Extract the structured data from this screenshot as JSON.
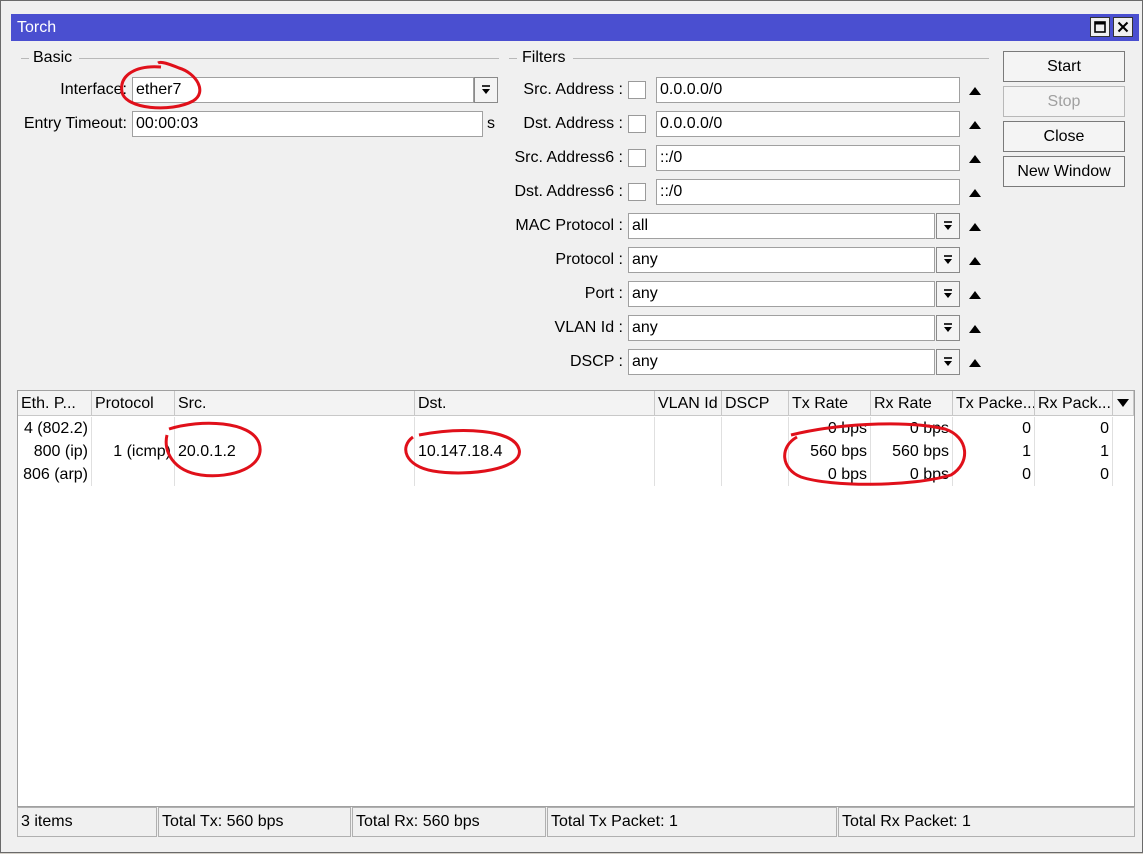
{
  "window": {
    "title": "Torch"
  },
  "basic": {
    "group_label": "Basic",
    "interface_label": "Interface:",
    "interface_value": "ether7",
    "timeout_label": "Entry Timeout:",
    "timeout_value": "00:00:03",
    "timeout_unit": "s"
  },
  "filters": {
    "group_label": "Filters",
    "src_address": {
      "label": "Src. Address :",
      "value": "0.0.0.0/0"
    },
    "dst_address": {
      "label": "Dst. Address :",
      "value": "0.0.0.0/0"
    },
    "src_address6": {
      "label": "Src. Address6 :",
      "value": "::/0"
    },
    "dst_address6": {
      "label": "Dst. Address6 :",
      "value": "::/0"
    },
    "mac_protocol": {
      "label": "MAC Protocol :",
      "value": "all"
    },
    "protocol": {
      "label": "Protocol :",
      "value": "any"
    },
    "port": {
      "label": "Port :",
      "value": "any"
    },
    "vlan_id": {
      "label": "VLAN Id :",
      "value": "any"
    },
    "dscp": {
      "label": "DSCP :",
      "value": "any"
    }
  },
  "buttons": {
    "start": "Start",
    "stop": "Stop",
    "close": "Close",
    "new_window": "New Window"
  },
  "table": {
    "headers": [
      "Eth. P...",
      "Protocol",
      "Src.",
      "Dst.",
      "VLAN Id",
      "DSCP",
      "Tx Rate",
      "Rx Rate",
      "Tx Packe...",
      "Rx Pack..."
    ],
    "rows": [
      [
        "4 (802.2)",
        "",
        "",
        "",
        "",
        "",
        "0 bps",
        "0 bps",
        "0",
        "0"
      ],
      [
        "800 (ip)",
        "1 (icmp)",
        "20.0.1.2",
        "10.147.18.4",
        "",
        "",
        "560 bps",
        "560 bps",
        "1",
        "1"
      ],
      [
        "806 (arp)",
        "",
        "",
        "",
        "",
        "",
        "0 bps",
        "0 bps",
        "0",
        "0"
      ]
    ]
  },
  "status": {
    "items": "3 items",
    "total_tx": "Total Tx: 560 bps",
    "total_rx": "Total Rx: 560 bps",
    "total_tx_packet": "Total Tx Packet: 1",
    "total_rx_packet": "Total Rx Packet: 1"
  },
  "colors": {
    "titlebar": "#4a4fd0",
    "annotation": "#e0101a"
  }
}
